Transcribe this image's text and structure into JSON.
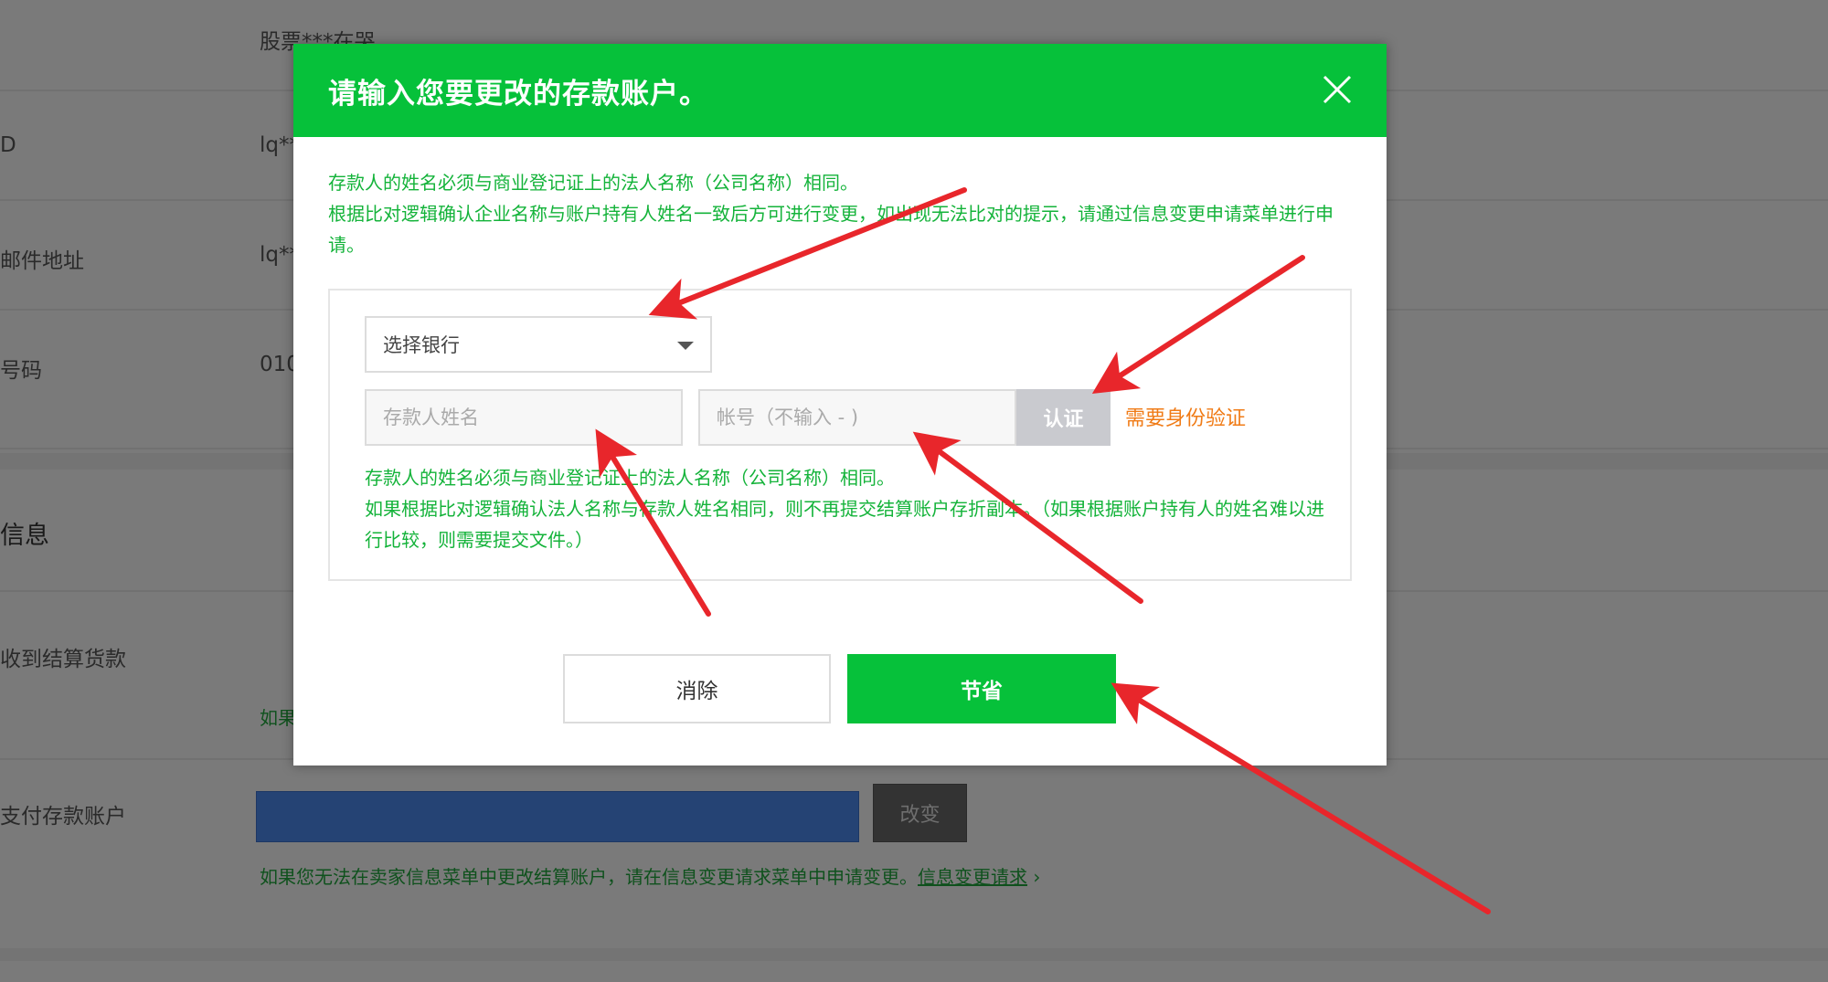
{
  "background": {
    "rows": [
      {
        "label": "",
        "value": "股票***在哭"
      },
      {
        "label": "D",
        "value": "lq**"
      },
      {
        "label": "邮件地址",
        "value": "lq**"
      },
      {
        "label": "号码",
        "value": "010"
      }
    ],
    "section_title": "信息",
    "settlement_label": "收到结算货款",
    "settlement_partial": "如果",
    "deposit_label": "支付存款账户",
    "change_button": "改变",
    "footer_note": "如果您无法在卖家信息菜单中更改结算账户，请在信息变更请求菜单中申请变更。",
    "footer_link": "信息变更请求",
    "footer_link_suffix": " ›"
  },
  "modal": {
    "title": "请输入您要更改的存款账户。",
    "notice_line1": "存款人的姓名必须与商业登记证上的法人名称（公司名称）相同。",
    "notice_line2": "根据比对逻辑确认企业名称与账户持有人姓名一致后方可进行变更，如出现无法比对的提示，请通过信息变更申请菜单进行申请。",
    "bank_select": {
      "selected": "选择银行"
    },
    "depositor_name": {
      "value": "",
      "placeholder": "存款人姓名"
    },
    "account_number": {
      "value": "",
      "placeholder": "帐号（不输入 - )"
    },
    "verify_button": "认证",
    "verify_note": "需要身份验证",
    "inner_notice_line1": "存款人的姓名必须与商业登记证上的法人名称（公司名称）相同。",
    "inner_notice_line2": "如果根据比对逻辑确认法人名称与存款人姓名相同，则不再提交结算账户存折副本。（如果根据账户持有人的姓名难以进行比较，则需要提交文件。）",
    "clear_button": "消除",
    "save_button": "节省"
  },
  "colors": {
    "header_green": "#06c13a",
    "notice_green": "#14b33a",
    "warning_orange": "#f07b16",
    "annotation_red": "#e8262b"
  },
  "icons": {
    "close": "close-icon",
    "dropdown": "caret-down-icon"
  }
}
